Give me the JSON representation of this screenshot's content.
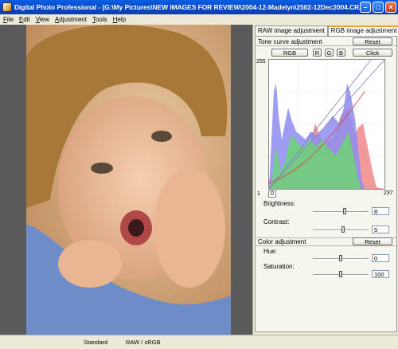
{
  "window": {
    "title": "Digital Photo Professional - [G:\\My Pictures\\NEW IMAGES FOR REVIEW\\2004-12-Madelyn\\2502-12Dec2004.CR..."
  },
  "menu": [
    "File",
    "Edit",
    "View",
    "Adjustment",
    "Tools",
    "Help"
  ],
  "tabs": [
    "RAW image adjustment",
    "RGB image adjustment"
  ],
  "tone_curve": {
    "heading": "Tone curve adjustment",
    "reset_label": "Reset",
    "rgb_label": "RGB",
    "r_label": "R",
    "g_label": "G",
    "b_label": "B",
    "click_label": "Click",
    "y_max": "255",
    "y_min": "1",
    "x_min": "0",
    "x_max": "237"
  },
  "brightness": {
    "label": "Brightness:",
    "value": "8",
    "level": 0.58
  },
  "contrast": {
    "label": "Contrast:",
    "value": "5",
    "level": 0.54
  },
  "color_adjustment": {
    "heading": "Color adjustment",
    "reset_label": "Reset"
  },
  "hue": {
    "label": "Hue:",
    "value": "0",
    "level": 0.5
  },
  "saturation": {
    "label": "Saturation:",
    "value": "100",
    "level": 0.5
  },
  "status": {
    "mode": "Standard",
    "format": "RAW / sRGB"
  },
  "colors": {
    "title_bar": "#0848c8",
    "hist_blue": "#8c8cf0",
    "hist_green": "#6cd86c",
    "hist_red": "#f08888"
  }
}
